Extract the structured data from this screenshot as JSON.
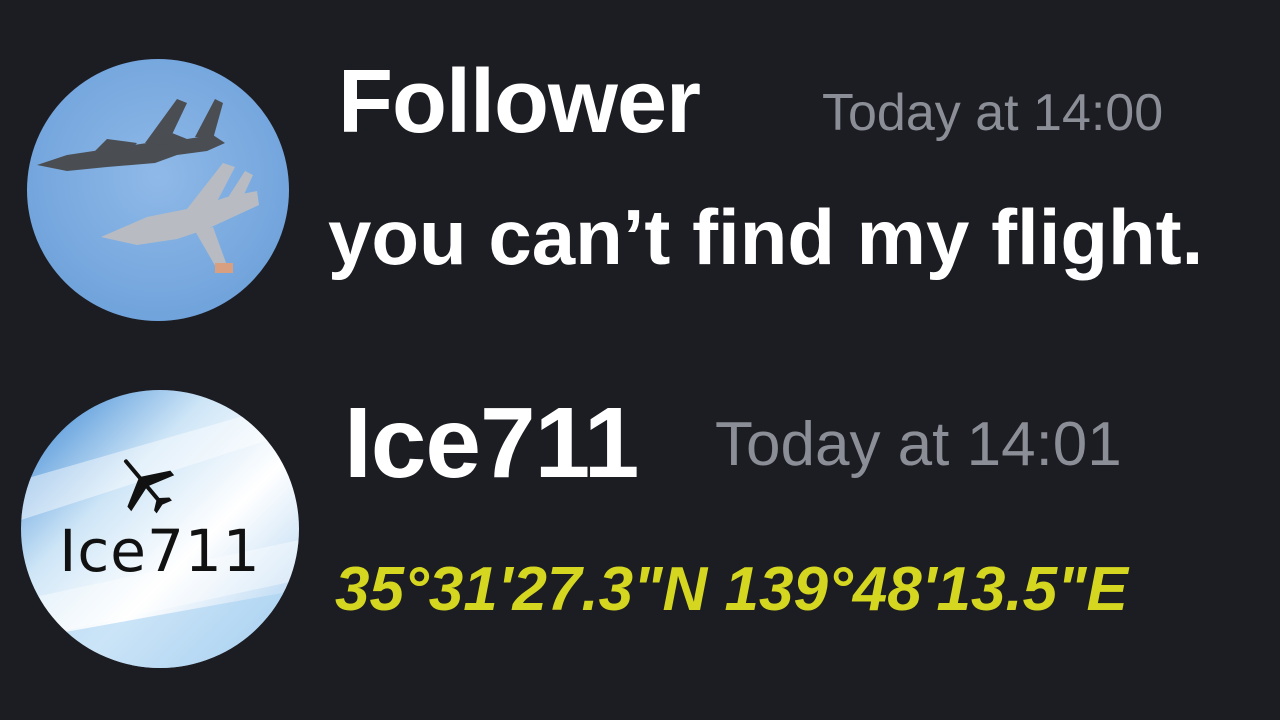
{
  "messages": [
    {
      "author": "Follower",
      "timestamp": "Today at 14:00",
      "text": "you can’t find my flight.",
      "avatar": {
        "icon": "fighter-jets-photo"
      }
    },
    {
      "author": "Ice711",
      "timestamp": "Today at 14:01",
      "text": "35°31'27.3\"N 139°48'13.5\"E",
      "avatar": {
        "icon": "airplane-icon",
        "label": "Ice711"
      }
    }
  ],
  "colors": {
    "background": "#1c1d22",
    "author": "#ffffff",
    "timestamp": "#8b8e96",
    "message_text": "#ffffff",
    "highlight_text": "#d4d620"
  }
}
